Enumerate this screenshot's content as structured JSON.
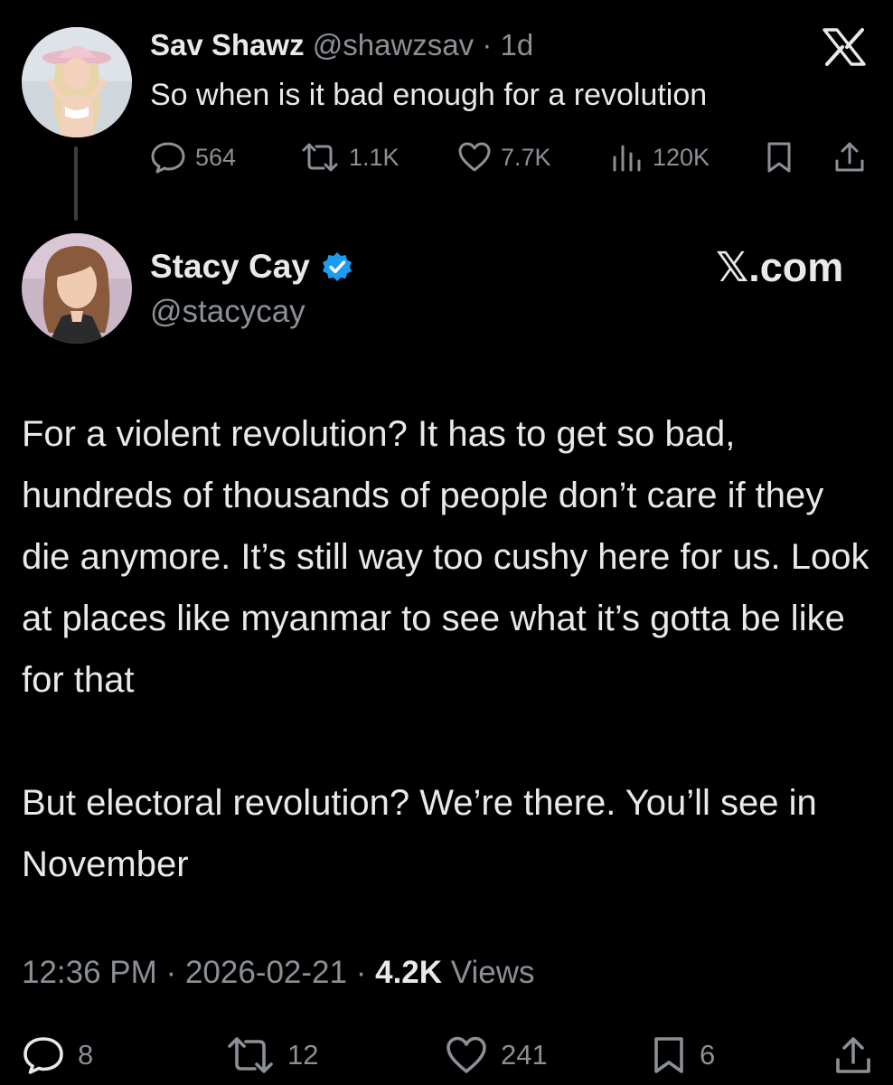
{
  "parent_tweet": {
    "display_name": "Sav Shawz",
    "handle": "@shawzsav",
    "separator": "·",
    "time_ago": "1d",
    "text": "So when is it bad enough for a revolution",
    "metrics": {
      "replies": "564",
      "reposts": "1.1K",
      "likes": "7.7K",
      "views": "120K"
    },
    "icons": [
      "reply-icon",
      "repost-icon",
      "like-icon",
      "views-icon",
      "bookmark-icon",
      "share-icon"
    ]
  },
  "main_tweet": {
    "display_name": "Stacy Cay",
    "handle": "@stacycay",
    "verified": true,
    "watermark": "𝕏.com",
    "paragraphs": [
      "For a violent revolution? It has to get so bad, hundreds of thousands of people don’t care if they die anymore. It’s still way too cushy here for us. Look at places like myanmar to see what it’s gotta be like for that",
      "But electoral revolution? We’re there. You’ll see in November"
    ],
    "time": "12:36 PM",
    "date": "2026-02-21",
    "separator": "·",
    "views_count": "4.2K",
    "views_label": "Views",
    "metrics": {
      "replies": "8",
      "reposts": "12",
      "likes": "241",
      "bookmarks": "6"
    }
  },
  "colors": {
    "background": "#000000",
    "primary_text": "#e7e9ea",
    "secondary_text": "#8b9096",
    "verified_badge": "#1d9bf0"
  }
}
